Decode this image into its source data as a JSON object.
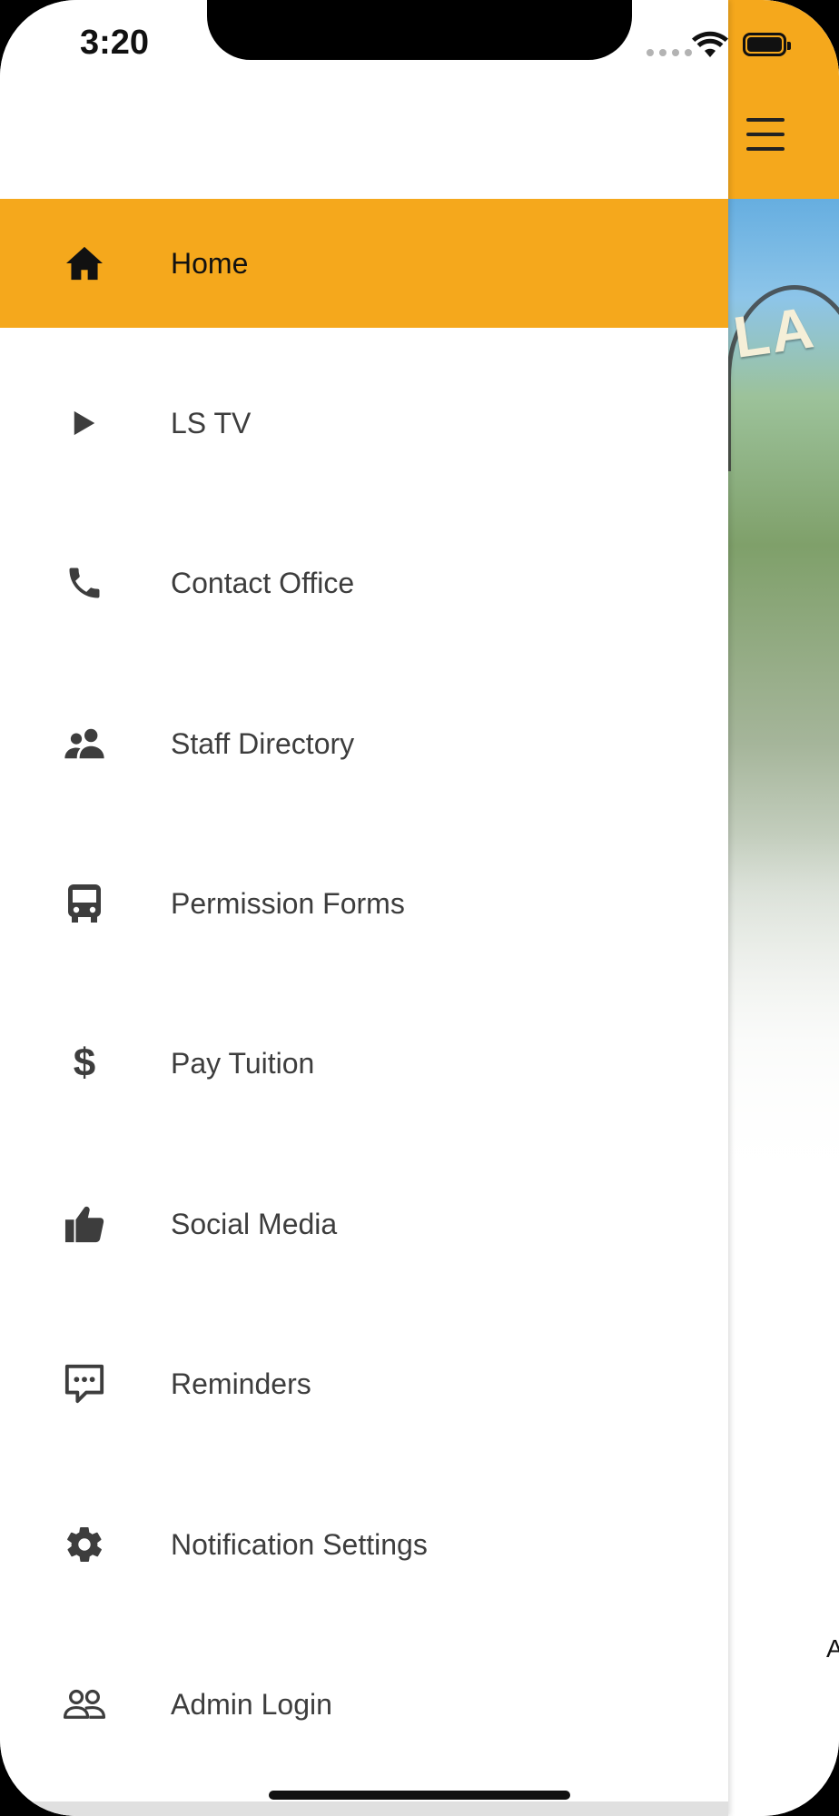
{
  "status_bar": {
    "time": "3:20"
  },
  "menu": {
    "items": [
      {
        "label": "Home",
        "icon": "home-icon",
        "active": true
      },
      {
        "label": "LS TV",
        "icon": "play-icon"
      },
      {
        "label": "Contact Office",
        "icon": "phone-icon"
      },
      {
        "label": "Staff Directory",
        "icon": "people-icon"
      },
      {
        "label": "Permission Forms",
        "icon": "bus-icon"
      },
      {
        "label": "Pay Tuition",
        "icon": "dollar-icon"
      },
      {
        "label": "Social Media",
        "icon": "thumbs-up-icon"
      },
      {
        "label": "Reminders",
        "icon": "chat-bubble-icon"
      },
      {
        "label": "Notification Settings",
        "icon": "gear-icon"
      },
      {
        "label": "Admin Login",
        "icon": "admin-users-icon"
      }
    ]
  },
  "app": {
    "hero_partial_text": "LA",
    "peek_text": "A"
  },
  "colors": {
    "accent": "#F5A81C",
    "icon": "#3d3d3d"
  }
}
